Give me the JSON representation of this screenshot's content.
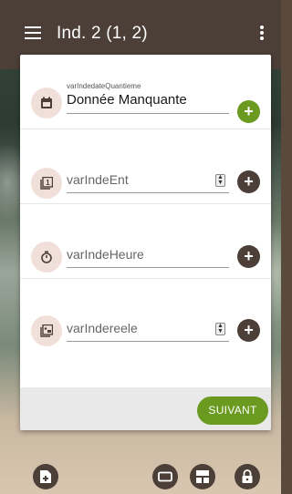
{
  "app": {
    "title": "Ind. 2 (1, 2)"
  },
  "icons": {
    "menu": "menu-icon",
    "more": "more-vert-icon",
    "add": "+"
  },
  "fields": [
    {
      "caption": "varIndedateQuantieme",
      "value": "Donnée Manquante",
      "icon": "calendar-icon",
      "accent": "green"
    },
    {
      "placeholder": "varIndeEnt",
      "icon": "number-one-icon",
      "accent": "dark",
      "spinner": true
    },
    {
      "placeholder": "varIndeHeure",
      "icon": "timer-icon",
      "accent": "dark"
    },
    {
      "placeholder": "varIndereele",
      "icon": "decimal-icon",
      "accent": "dark",
      "spinner": true
    }
  ],
  "footer": {
    "next_label": "SUIVANT"
  },
  "bottom_actions": [
    "add-file-icon",
    "rectangle-icon",
    "layout-icon",
    "lock-icon"
  ],
  "colors": {
    "appbar": "#4b3f37",
    "accent_green": "#6a9a1f",
    "icon_bg": "#f1e0d9"
  }
}
